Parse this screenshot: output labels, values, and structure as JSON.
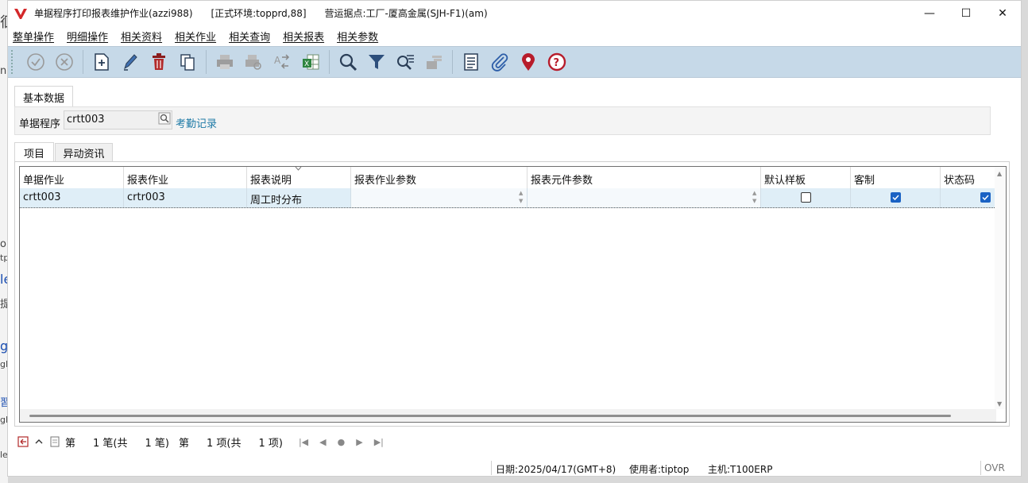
{
  "window": {
    "title": "单据程序打印报表维护作业(azzi988)      [正式环境:topprd,88]      营运据点:工厂-厦高金属(SJH-F1)(am)",
    "minimize": "—",
    "maximize": "☐",
    "close": "✕"
  },
  "menu": [
    "整单操作",
    "明细操作",
    "相关资料",
    "相关作业",
    "相关查询",
    "相关报表",
    "相关参数"
  ],
  "toolbar": {
    "icons": [
      "confirm-icon",
      "cancel-icon",
      "add-icon",
      "edit-icon",
      "delete-icon",
      "copy-icon",
      "print-icon",
      "print-preview-icon",
      "convert-icon",
      "excel-export-icon",
      "search-icon",
      "filter-icon",
      "advanced-query-icon",
      "storage-icon",
      "document-list-icon",
      "attachment-icon",
      "location-icon",
      "help-icon"
    ]
  },
  "tabs": {
    "basic": "基本数据",
    "items": "项目",
    "changes": "异动资讯"
  },
  "form": {
    "label": "单据程序",
    "value": "crtt003",
    "description": "考勤记录"
  },
  "grid": {
    "columns": [
      "单据作业",
      "报表作业",
      "报表说明",
      "报表作业参数",
      "报表元件参数",
      "默认样板",
      "客制",
      "状态码"
    ],
    "rows": [
      {
        "doc_job": "crtt003",
        "report_job": "crtr003",
        "report_desc": "周工时分布",
        "report_params": "",
        "component_params": "",
        "default_template": false,
        "custom": true,
        "status": true
      }
    ]
  },
  "pager": {
    "di": "第",
    "record_count_a": "1 笔(共",
    "record_count_b": "1 笔)",
    "di2": "第",
    "page_a": "1 项(共",
    "page_b": "1 项)"
  },
  "status": {
    "date": "日期:2025/04/17(GMT+8)",
    "user": "使用者:tiptop",
    "host": "主机:T100ERP",
    "mode": "OVR"
  },
  "colors": {
    "toolbar_bg": "#c6d9e8",
    "row_selected": "#dfeef7",
    "link": "#1e7aa6",
    "checkbox_on": "#1a62c4"
  }
}
